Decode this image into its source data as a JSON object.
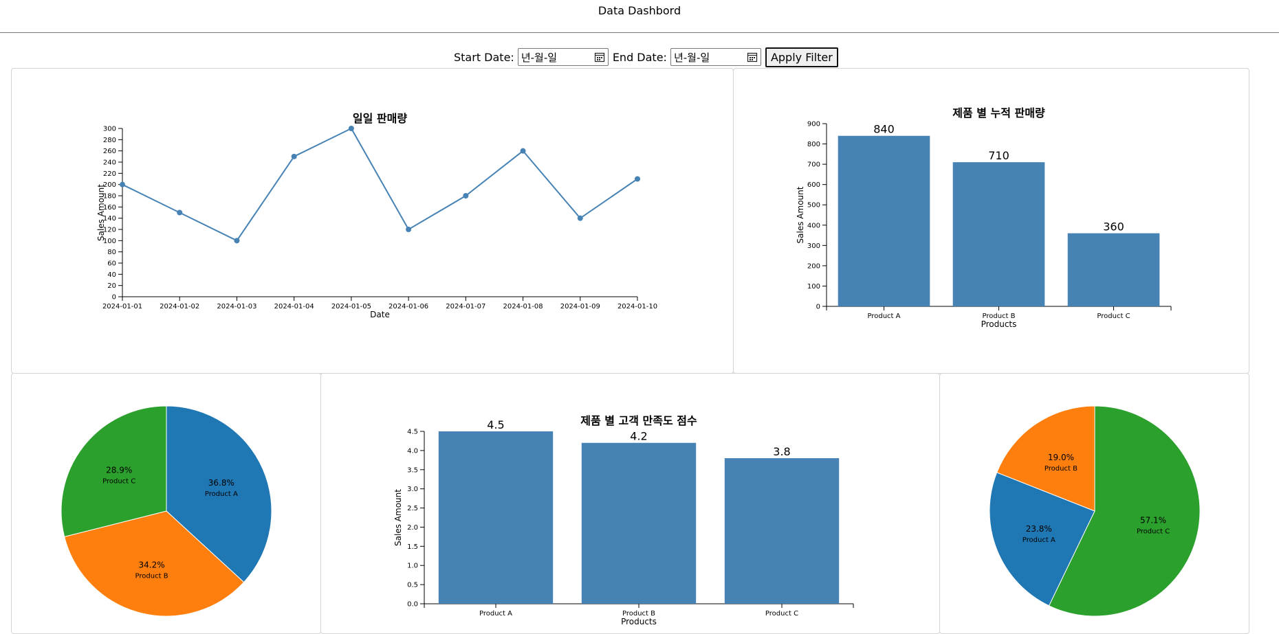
{
  "header": {
    "title": "Data Dashbord"
  },
  "filter": {
    "start_label": "Start Date:",
    "start_placeholder": "년-월-일",
    "end_label": "End Date:",
    "end_placeholder": "년-월-일",
    "apply_label": "Apply Filter"
  },
  "colors": {
    "bar": "#4682b4",
    "line": "#4682b4",
    "pie_blue": "#1f77b4",
    "pie_orange": "#ff7f0e",
    "pie_green": "#2ca02c"
  },
  "chart_data": [
    {
      "id": "daily",
      "type": "line",
      "title": "일일 판매량",
      "xlabel": "Date",
      "ylabel": "Sales Amount",
      "x": [
        "2024-01-01",
        "2024-01-02",
        "2024-01-03",
        "2024-01-04",
        "2024-01-05",
        "2024-01-06",
        "2024-01-07",
        "2024-01-08",
        "2024-01-09",
        "2024-01-10"
      ],
      "values": [
        200,
        150,
        100,
        250,
        300,
        120,
        180,
        260,
        140,
        210
      ],
      "ylim": [
        0,
        300
      ],
      "yticks": [
        0,
        20,
        40,
        60,
        80,
        100,
        120,
        140,
        160,
        180,
        200,
        220,
        240,
        260,
        280,
        300
      ],
      "grid": false
    },
    {
      "id": "cumulative",
      "type": "bar",
      "title": "제품 별 누적 판매량",
      "xlabel": "Products",
      "ylabel": "Sales Amount",
      "categories": [
        "Product A",
        "Product B",
        "Product C"
      ],
      "values": [
        840,
        710,
        360
      ],
      "ylim": [
        0,
        900
      ],
      "yticks": [
        0,
        100,
        200,
        300,
        400,
        500,
        600,
        700,
        800,
        900
      ],
      "grid": false
    },
    {
      "id": "pie-left",
      "type": "pie",
      "labels": [
        "Product A",
        "Product B",
        "Product C"
      ],
      "values": [
        36.8,
        34.2,
        28.9
      ],
      "colors": [
        "#1f77b4",
        "#ff7f0e",
        "#2ca02c"
      ]
    },
    {
      "id": "satisfaction",
      "type": "bar",
      "title": "제품 별 고객 만족도 점수",
      "xlabel": "Products",
      "ylabel": "Sales Amount",
      "categories": [
        "Product A",
        "Product B",
        "Product C"
      ],
      "values": [
        4.5,
        4.2,
        3.8
      ],
      "ylim": [
        0,
        4.5
      ],
      "yticks": [
        "0.0",
        "0.5",
        "1.0",
        "1.5",
        "2.0",
        "2.5",
        "3.0",
        "3.5",
        "4.0",
        "4.5"
      ],
      "grid": false
    },
    {
      "id": "pie-right",
      "type": "pie",
      "labels": [
        "Product C",
        "Product A",
        "Product B"
      ],
      "values": [
        57.1,
        23.8,
        19.0
      ],
      "colors": [
        "#2ca02c",
        "#1f77b4",
        "#ff7f0e"
      ]
    }
  ]
}
